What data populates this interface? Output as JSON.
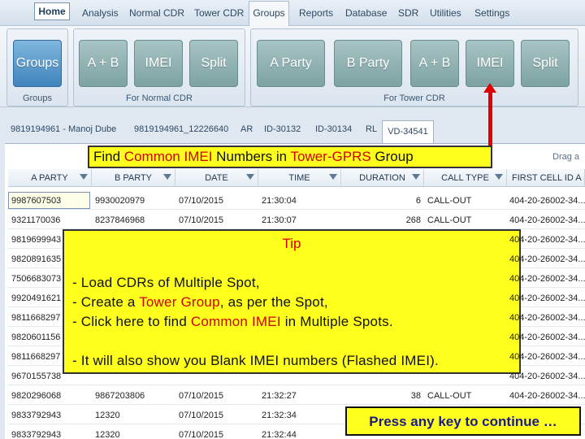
{
  "menu": {
    "home": "Home",
    "items": [
      "Analysis",
      "Normal CDR",
      "Tower CDR",
      "Groups",
      "Reports",
      "Database",
      "SDR",
      "Utilities",
      "Settings"
    ]
  },
  "ribbon": {
    "groups_group": {
      "button": "Groups",
      "label": "Groups"
    },
    "normal_cdr_group": {
      "buttons": [
        "A + B",
        "IMEI",
        "Split"
      ],
      "label": "For Normal CDR"
    },
    "tower_cdr_group": {
      "buttons": [
        "A Party",
        "B Party",
        "A + B",
        "IMEI",
        "Split"
      ],
      "label": "For Tower CDR"
    }
  },
  "tabs": [
    "9819194961 - Manoj Dube",
    "9819194961_12226640",
    "AR",
    "ID-30132",
    "ID-30134",
    "RL",
    "VD-34541"
  ],
  "grid": {
    "drag_hint": "Drag a",
    "columns": [
      "A PARTY",
      "B PARTY",
      "DATE",
      "TIME",
      "DURATION",
      "CALL TYPE",
      "FIRST CELL ID A"
    ],
    "rows": [
      [
        "9987607503",
        "9930020979",
        "07/10/2015",
        "21:30:04",
        "6",
        "CALL-OUT",
        "404-20-26002-34..."
      ],
      [
        "9321170036",
        "8237846968",
        "07/10/2015",
        "21:30:07",
        "268",
        "CALL-OUT",
        "404-20-26002-34..."
      ],
      [
        "9819699943",
        "",
        "",
        "",
        "",
        "",
        "404-20-26002-34..."
      ],
      [
        "9820891635",
        "",
        "",
        "",
        "",
        "",
        "404-20-26002-34..."
      ],
      [
        "7506683073",
        "",
        "",
        "",
        "",
        "",
        "404-20-26002-34..."
      ],
      [
        "9920491621",
        "",
        "",
        "",
        "",
        "",
        "404-20-26002-34..."
      ],
      [
        "9811668297",
        "",
        "",
        "",
        "",
        "",
        "404-20-26002-34..."
      ],
      [
        "9820601156",
        "",
        "",
        "",
        "",
        "",
        "404-20-26002-34..."
      ],
      [
        "9811668297",
        "",
        "",
        "",
        "",
        "",
        "404-20-26002-34..."
      ],
      [
        "9670155738",
        "",
        "",
        "",
        "",
        "",
        "404-20-26002-34..."
      ],
      [
        "9820296068",
        "9867203806",
        "07/10/2015",
        "21:32:27",
        "38",
        "CALL-OUT",
        "404-20-26002-34..."
      ],
      [
        "9833792943",
        "12320",
        "07/10/2015",
        "21:32:34",
        "",
        "",
        ""
      ],
      [
        "9833792943",
        "12320",
        "07/10/2015",
        "21:32:44",
        "",
        "",
        ""
      ]
    ]
  },
  "callout_top": {
    "p1": "Find ",
    "p2": "Common IMEI",
    "p3": " Numbers in ",
    "p4": "Tower-GPRS",
    "p5": " Group"
  },
  "tip": {
    "title": "Tip",
    "line1": "- Load CDRs of Multiple Spot,",
    "line2a": "- Create a ",
    "line2b": "Tower Group",
    "line2c": ", as per the Spot,",
    "line3a": "- Click here to find ",
    "line3b": "Common IMEI",
    "line3c": " in Multiple Spots.",
    "line4": "- It will also show you Blank IMEI numbers (Flashed IMEI)."
  },
  "press_key": "Press any key to continue …",
  "colors": {
    "callout_bg": "#ffff1e",
    "accent_red": "#d10000",
    "ribbon_blue": "#3f84bd"
  }
}
